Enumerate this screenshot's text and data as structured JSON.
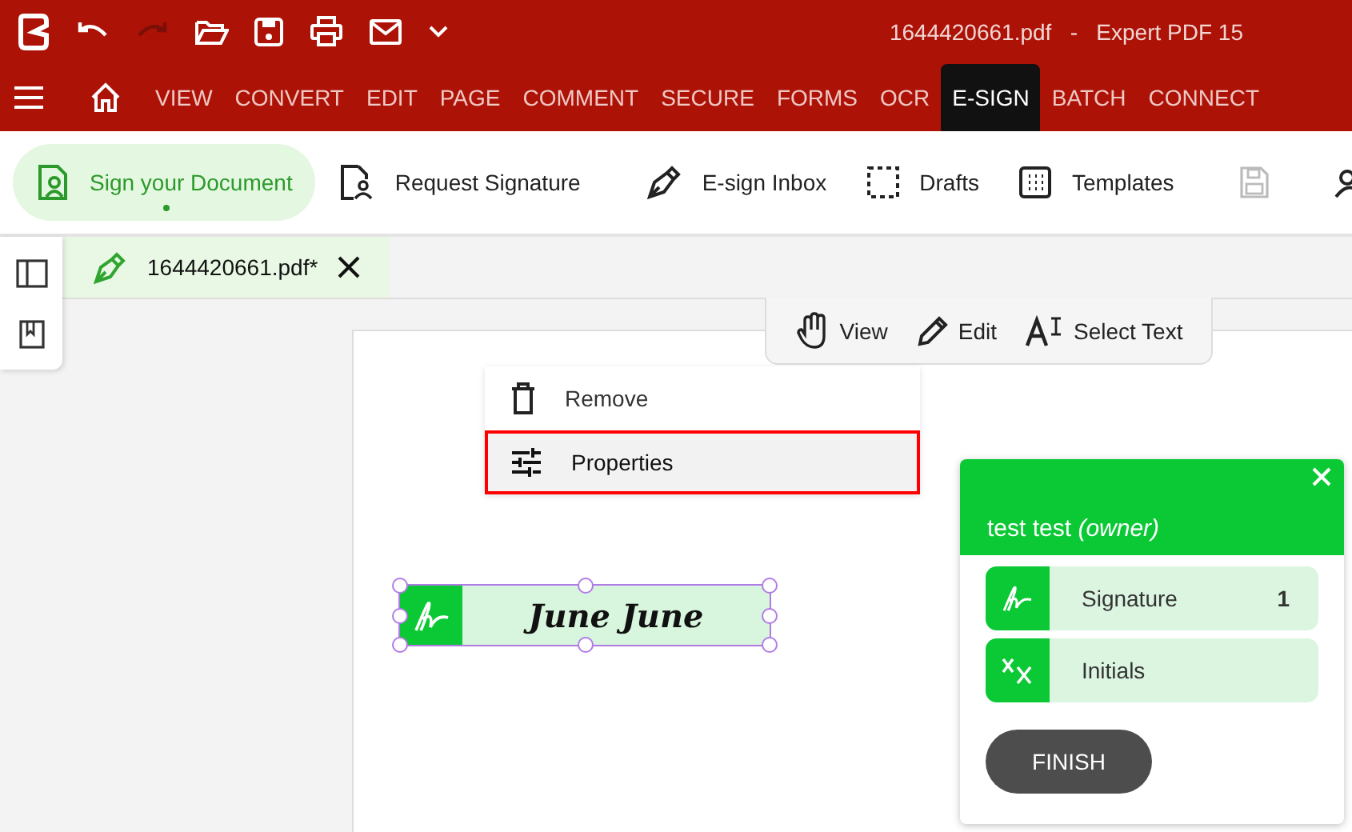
{
  "window": {
    "title": "1644420661.pdf   -   Expert PDF 15"
  },
  "menu": [
    {
      "label": "VIEW",
      "selected": false
    },
    {
      "label": "CONVERT",
      "selected": false
    },
    {
      "label": "EDIT",
      "selected": false
    },
    {
      "label": "PAGE",
      "selected": false
    },
    {
      "label": "COMMENT",
      "selected": false
    },
    {
      "label": "SECURE",
      "selected": false
    },
    {
      "label": "FORMS",
      "selected": false
    },
    {
      "label": "OCR",
      "selected": false
    },
    {
      "label": "E-SIGN",
      "selected": true
    },
    {
      "label": "BATCH",
      "selected": false
    },
    {
      "label": "CONNECT",
      "selected": false
    }
  ],
  "toolbar": [
    {
      "kind": "sign",
      "label": "Sign your Document",
      "selected": true,
      "disabled": false
    },
    {
      "kind": "request",
      "label": "Request Signature",
      "selected": false,
      "disabled": false
    },
    {
      "kind": "inbox",
      "label": "E-sign Inbox",
      "selected": false,
      "disabled": false
    },
    {
      "kind": "drafts",
      "label": "Drafts",
      "selected": false,
      "disabled": false
    },
    {
      "kind": "templates",
      "label": "Templates",
      "selected": false,
      "disabled": false
    },
    {
      "kind": "save",
      "selected": false,
      "disabled": true
    },
    {
      "kind": "people",
      "selected": false,
      "disabled": false
    }
  ],
  "document_tab": {
    "label": "1644420661.pdf*"
  },
  "mode_bar": [
    {
      "kind": "view",
      "label": "View"
    },
    {
      "kind": "edit",
      "label": "Edit"
    },
    {
      "kind": "select",
      "label": "Select Text"
    }
  ],
  "context_menu": [
    {
      "kind": "remove",
      "label": "Remove",
      "selected": false
    },
    {
      "kind": "properties",
      "label": "Properties",
      "selected": true
    }
  ],
  "signature_field": {
    "text": "June June",
    "selected": true
  },
  "signer_panel": {
    "name": "test test *(owner)*",
    "fields": [
      {
        "kind": "signature",
        "label": "Signature",
        "count": "1"
      },
      {
        "kind": "initials",
        "label": "Initials"
      }
    ],
    "button": "FINISH"
  }
}
